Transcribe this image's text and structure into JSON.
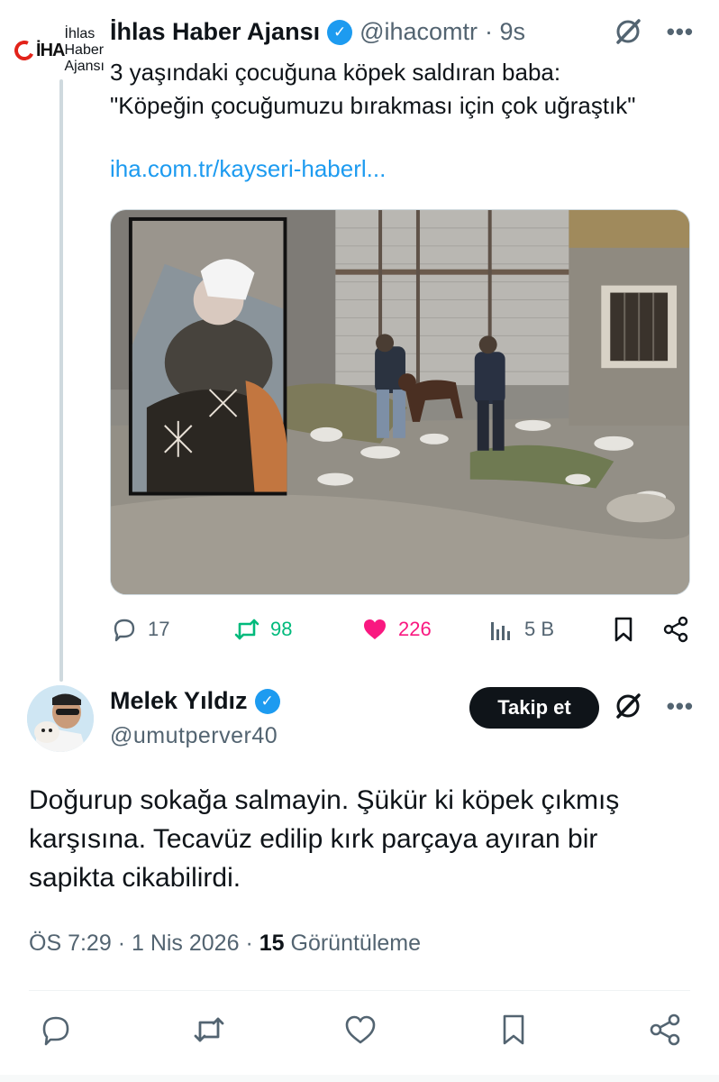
{
  "parent_tweet": {
    "author_name": "İhlas Haber Ajansı",
    "author_handle": "@ihacomtr",
    "time": "· 9s",
    "avatar_logo_text": "İHA",
    "avatar_logo_sub": "İhlas Haber Ajansı",
    "text_line1": "3 yaşındaki çocuğuna köpek saldıran baba:",
    "text_line2": "\"Köpeğin çocuğumuzu bırakması için çok uğraştık\"",
    "link": "iha.com.tr/kayseri-haberl...",
    "icons": {
      "grok": "grok-icon",
      "more": "more-icon"
    },
    "actions": {
      "replies": "17",
      "reposts": "98",
      "likes": "226",
      "views": "5 B"
    },
    "colors": {
      "link": "#1d9bf0",
      "repost": "#00ba7c",
      "like": "#f91880",
      "verified": "#1d9bf0"
    }
  },
  "reply_tweet": {
    "author_name": "Melek Yıldız",
    "author_handle": "@umutperver40",
    "follow_label": "Takip et",
    "text_line1": "Doğurup sokağa salmayin. Şükür ki köpek çıkmış",
    "text_line2": "karşısına. Tecavüz edilip kırk parçaya ayıran bir",
    "text_line3": "sapikta cikabilirdi.",
    "time": "ÖS 7:29",
    "date": "1 Nis 2026",
    "views_count": "15",
    "views_label": "Görüntüleme"
  }
}
